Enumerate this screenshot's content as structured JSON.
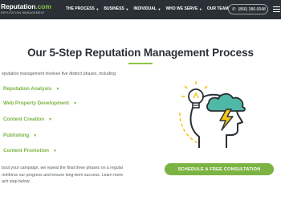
{
  "header": {
    "logo_name": "Reputation",
    "logo_suffix": ".com",
    "logo_tagline": "REPUTATION MANAGEMENT",
    "nav": [
      {
        "label": "THE PROCESS",
        "has_caret": true
      },
      {
        "label": "BUSINESS",
        "has_caret": true
      },
      {
        "label": "INDIVIDUAL",
        "has_caret": true
      },
      {
        "label": "WHO WE SERVE",
        "has_caret": true
      },
      {
        "label": "OUR TEAM",
        "has_caret": false
      }
    ],
    "phone": "(866) 386-0048",
    "icons": {
      "phone": "phone-icon",
      "menu": "hamburger-menu-icon",
      "caret": "chevron-down-icon"
    }
  },
  "main": {
    "title": "Our 5-Step Reputation Management Process",
    "intro": "eputation management involves five distinct phases, including:",
    "phases": [
      {
        "label": "Reputation Analysis"
      },
      {
        "label": "Web Property Development"
      },
      {
        "label": "Content Creation"
      },
      {
        "label": "Publishing"
      },
      {
        "label": "Content Promotion"
      }
    ],
    "outro_lines": [
      "bout your campaign, we repeat the final three phases on a regular",
      "reinforce our progress and ensure long-term success. Learn more",
      "ach step below."
    ],
    "cta_label": "SCHEDULE A FREE CONSULTATION"
  },
  "colors": {
    "navbar_bg": "#2a3035",
    "accent_green": "#7cb342",
    "title_text": "#2a3035",
    "illustration_yellow": "#f5c518",
    "illustration_teal": "#4fb8a6"
  }
}
